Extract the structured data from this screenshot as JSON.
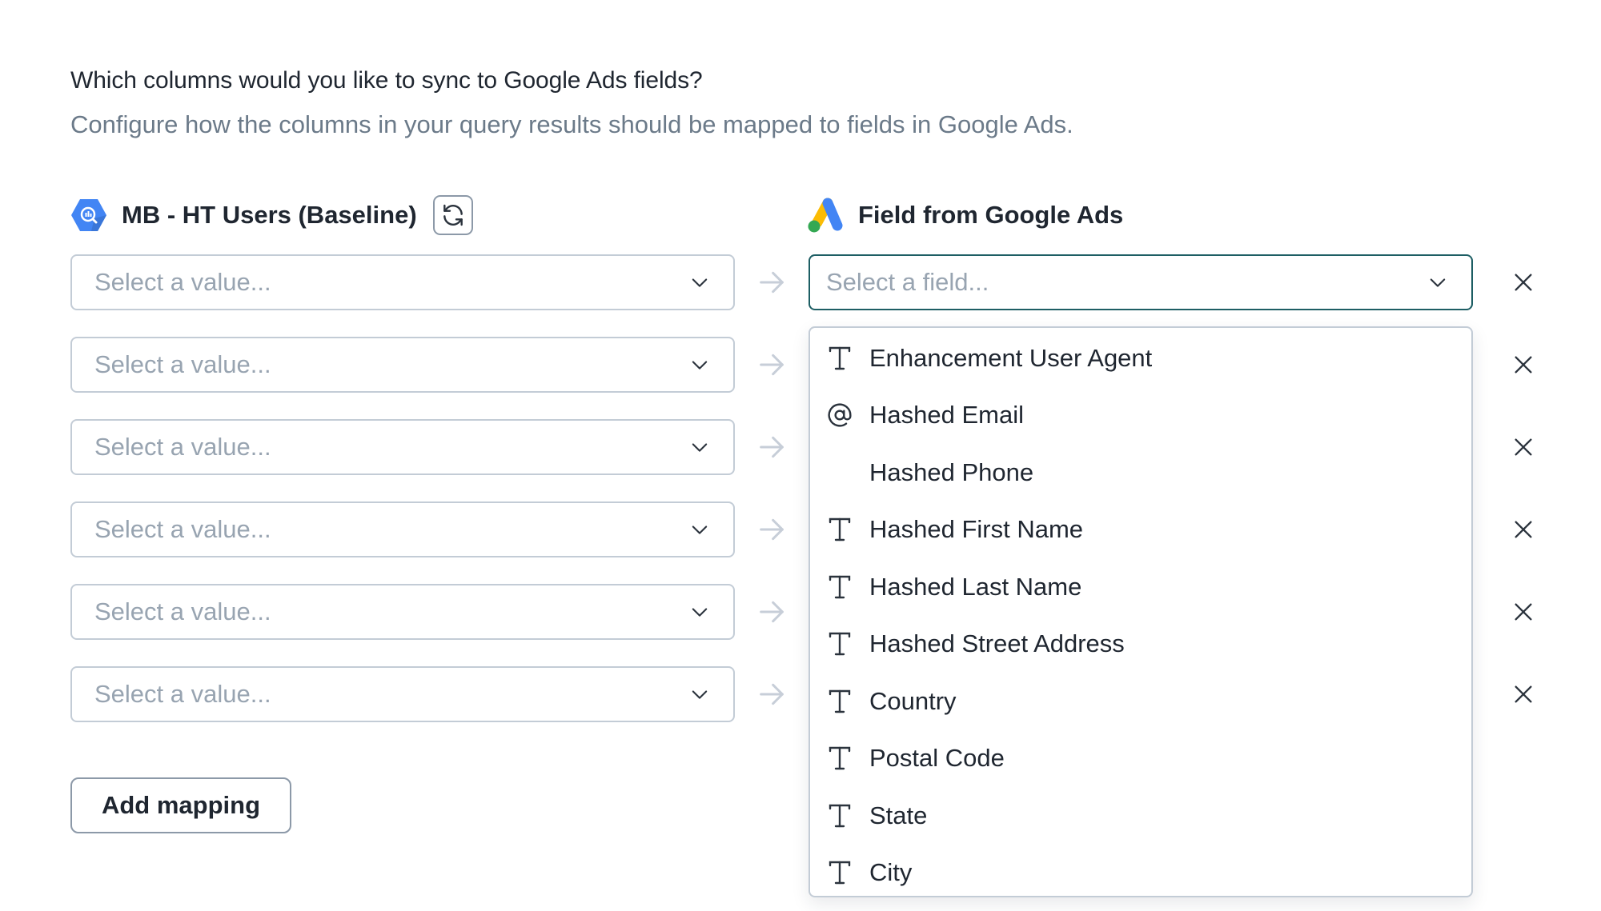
{
  "section": {
    "heading": "Which columns would you like to sync to Google Ads fields?",
    "subtitle": "Configure how the columns in your query results should be mapped to fields in Google Ads."
  },
  "source": {
    "icon": "bigquery-icon",
    "title": "MB - HT Users (Baseline)",
    "refresh_icon": "refresh-icon"
  },
  "destination": {
    "icon": "google-ads-icon",
    "title": "Field from Google Ads"
  },
  "mappings": [
    {
      "source_placeholder": "Select a value...",
      "field_placeholder": "Select a field...",
      "focused": true
    },
    {
      "source_placeholder": "Select a value..."
    },
    {
      "source_placeholder": "Select a value..."
    },
    {
      "source_placeholder": "Select a value..."
    },
    {
      "source_placeholder": "Select a value..."
    },
    {
      "source_placeholder": "Select a value..."
    }
  ],
  "field_dropdown": {
    "options": [
      {
        "label": "Enhancement User Agent",
        "icon": "text-type-icon"
      },
      {
        "label": "Hashed Email",
        "icon": "at-sign-icon"
      },
      {
        "label": "Hashed Phone",
        "icon": ""
      },
      {
        "label": "Hashed First Name",
        "icon": "text-type-icon"
      },
      {
        "label": "Hashed Last Name",
        "icon": "text-type-icon"
      },
      {
        "label": "Hashed Street Address",
        "icon": "text-type-icon"
      },
      {
        "label": "Country",
        "icon": "text-type-icon"
      },
      {
        "label": "Postal Code",
        "icon": "text-type-icon"
      },
      {
        "label": "State",
        "icon": "text-type-icon"
      },
      {
        "label": "City",
        "icon": "text-type-icon"
      }
    ]
  },
  "actions": {
    "add_mapping_label": "Add mapping"
  },
  "colors": {
    "focus_border": "#1d5e64",
    "input_border": "#c3ccd6",
    "placeholder": "#98a4b1",
    "heading_text": "#1f2630",
    "subtitle_text": "#6b7a89",
    "bigquery_blue": "#4285f4",
    "google_yellow": "#fbbc04",
    "google_green": "#34a853"
  }
}
